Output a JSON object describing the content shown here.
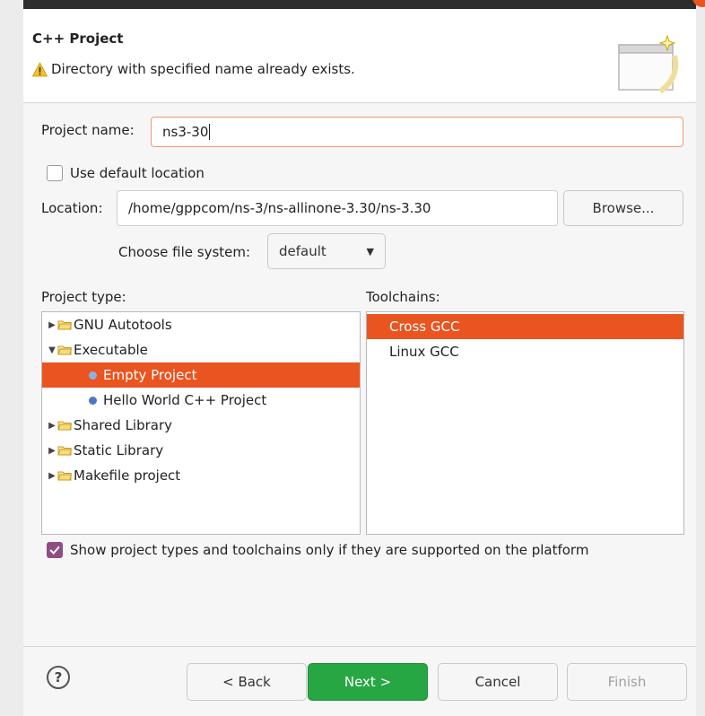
{
  "dialog": {
    "title": "C++ Project",
    "message": "Directory with specified name already exists."
  },
  "form": {
    "project_name_label": "Project name:",
    "project_name_value": "ns3-30",
    "use_default_label": "Use default location",
    "use_default_checked": false,
    "location_label": "Location:",
    "location_value": "/home/gppcom/ns-3/ns-allinone-3.30/ns-3.30",
    "browse_label": "Browse...",
    "file_system_label": "Choose file system:",
    "file_system_value": "default"
  },
  "project_type": {
    "label": "Project type:",
    "items": [
      {
        "label": "GNU Autotools",
        "kind": "folder",
        "expanded": false
      },
      {
        "label": "Executable",
        "kind": "folder",
        "expanded": true
      },
      {
        "label": "Empty Project",
        "kind": "leaf",
        "selected": true
      },
      {
        "label": "Hello World C++ Project",
        "kind": "leaf"
      },
      {
        "label": "Shared Library",
        "kind": "folder",
        "expanded": false
      },
      {
        "label": "Static Library",
        "kind": "folder",
        "expanded": false
      },
      {
        "label": "Makefile project",
        "kind": "folder",
        "expanded": false
      }
    ]
  },
  "toolchains": {
    "label": "Toolchains:",
    "items": [
      {
        "label": "Cross GCC",
        "selected": true
      },
      {
        "label": "Linux GCC"
      }
    ]
  },
  "filter": {
    "label": "Show project types and toolchains only if they are supported on the platform",
    "checked": true
  },
  "buttons": {
    "help": "?",
    "back": "< Back",
    "next": "Next >",
    "cancel": "Cancel",
    "finish": "Finish"
  },
  "colors": {
    "accent": "#e95420",
    "primary_button": "#26a744",
    "checkbox_on": "#8f4d84"
  }
}
